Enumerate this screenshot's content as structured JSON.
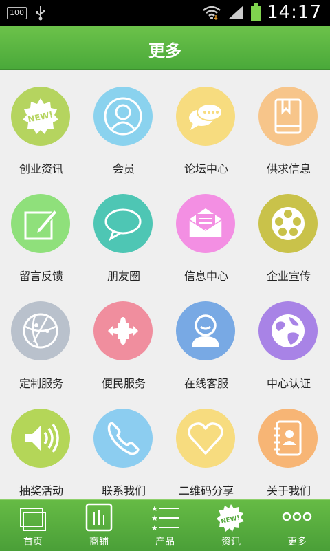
{
  "status_bar": {
    "battery_badge": "100",
    "time": "14:17"
  },
  "header": {
    "title": "更多"
  },
  "menu": [
    {
      "label": "创业资讯",
      "color": "#b5d45f",
      "icon": "new-badge-icon"
    },
    {
      "label": "会员",
      "color": "#8ad2ee",
      "icon": "user-icon"
    },
    {
      "label": "论坛中心",
      "color": "#f7dc7f",
      "icon": "chat-bubbles-icon"
    },
    {
      "label": "供求信息",
      "color": "#f7c58a",
      "icon": "book-icon"
    },
    {
      "label": "留言反馈",
      "color": "#8fe07b",
      "icon": "edit-icon"
    },
    {
      "label": "朋友圈",
      "color": "#4ec6b4",
      "icon": "speech-bubble-icon"
    },
    {
      "label": "信息中心",
      "color": "#f38fe3",
      "icon": "mail-icon"
    },
    {
      "label": "企业宣传",
      "color": "#c9c24a",
      "icon": "film-reel-icon"
    },
    {
      "label": "定制服务",
      "color": "#b9c1cc",
      "icon": "globe-network-icon"
    },
    {
      "label": "便民服务",
      "color": "#f08e9e",
      "icon": "puzzle-icon"
    },
    {
      "label": "在线客服",
      "color": "#78a9e4",
      "icon": "customer-service-icon"
    },
    {
      "label": "中心认证",
      "color": "#a883e6",
      "icon": "world-icon"
    },
    {
      "label": "抽奖活动",
      "color": "#b4d658",
      "icon": "speaker-icon"
    },
    {
      "label": "联系我们",
      "color": "#8ccdf0",
      "icon": "phone-icon"
    },
    {
      "label": "二维码分享",
      "color": "#f7dc7f",
      "icon": "heart-icon"
    },
    {
      "label": "关于我们",
      "color": "#f7b575",
      "icon": "contacts-book-icon"
    }
  ],
  "tabs": [
    {
      "label": "首页",
      "icon": "home-pages-icon"
    },
    {
      "label": "商铺",
      "icon": "shop-chart-icon"
    },
    {
      "label": "产品",
      "icon": "product-list-icon"
    },
    {
      "label": "资讯",
      "icon": "news-badge-icon"
    },
    {
      "label": "更多",
      "icon": "more-dots-icon"
    }
  ]
}
